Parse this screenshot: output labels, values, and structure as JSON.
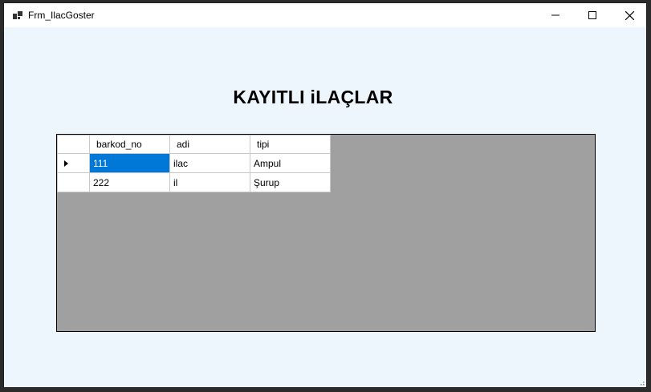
{
  "window": {
    "title": "Frm_IlacGoster"
  },
  "heading": "KAYITLI iLAÇLAR",
  "grid": {
    "columns": [
      "barkod_no",
      "adi",
      "tipi"
    ],
    "rows": [
      {
        "barkod_no": "111",
        "adi": "ilac",
        "tipi": "Ampul"
      },
      {
        "barkod_no": "222",
        "adi": "il",
        "tipi": "Şurup"
      }
    ]
  },
  "icons": {
    "app": "app-window-icon",
    "minimize": "minimize-icon",
    "maximize": "maximize-icon",
    "close": "close-icon",
    "current_row": "row-pointer-icon"
  },
  "colors": {
    "selection": "#0078d7",
    "grid_background": "#a0a0a0",
    "form_background": "#eef6fd"
  }
}
